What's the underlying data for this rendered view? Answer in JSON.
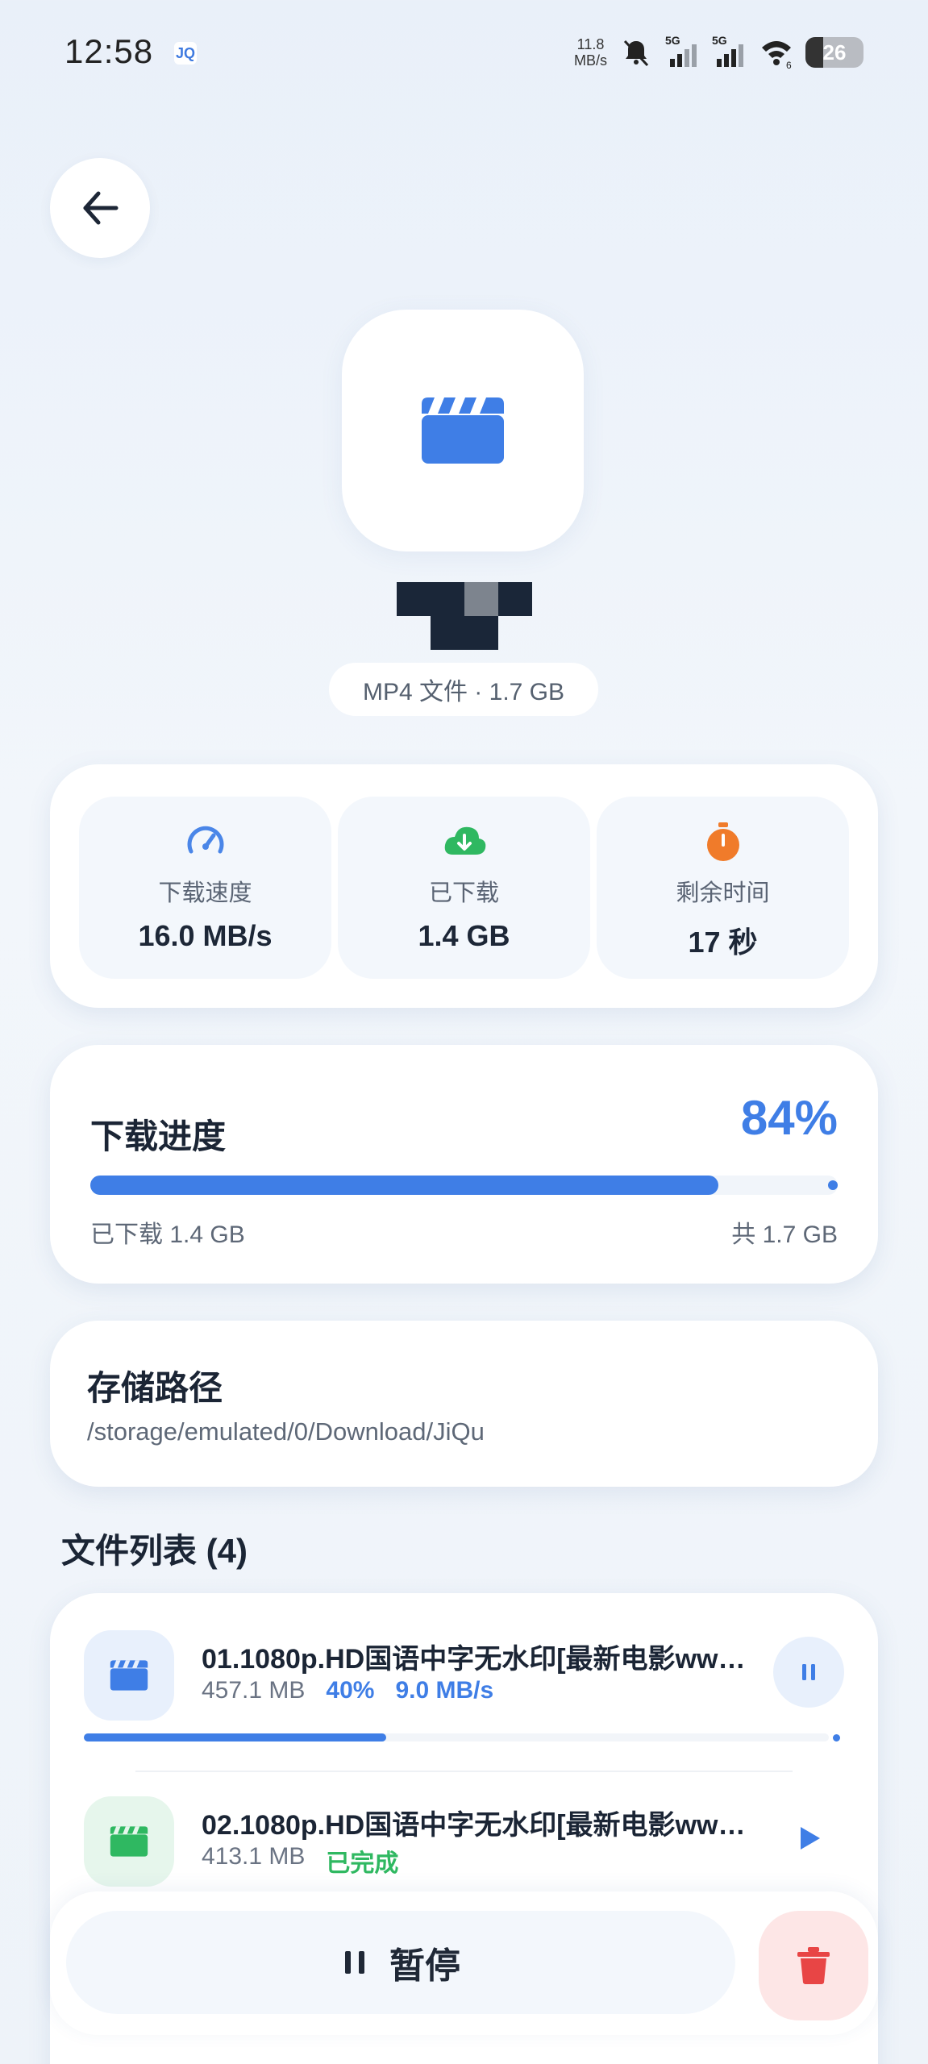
{
  "status_bar": {
    "time": "12:58",
    "app_icon": "JQ",
    "net_speed_value": "11.8",
    "net_speed_unit": "MB/s",
    "signal1_label": "5G",
    "signal2_label": "5G",
    "wifi_level": "6",
    "battery": "26",
    "icons": [
      "mute-bell-icon",
      "signal-icon",
      "signal-icon",
      "wifi-icon",
      "battery-icon"
    ]
  },
  "header": {
    "back_icon": "arrow-left-icon"
  },
  "hero": {
    "icon": "clapperboard-icon",
    "meta": "MP4 文件 · 1.7 GB"
  },
  "stats": [
    {
      "icon": "speedometer-icon",
      "label": "下载速度",
      "value": "16.0 MB/s",
      "color": "#4a86e8"
    },
    {
      "icon": "cloud-download-icon",
      "label": "已下载",
      "value": "1.4 GB",
      "color": "#2fb861"
    },
    {
      "icon": "stopwatch-icon",
      "label": "剩余时间",
      "value": "17 秒",
      "color": "#f07b2a"
    }
  ],
  "progress": {
    "title": "下载进度",
    "percent_label": "84%",
    "percent": 84,
    "downloaded_label": "已下载 1.4 GB",
    "total_label": "共 1.7 GB"
  },
  "storage": {
    "title": "存储路径",
    "path": "/storage/emulated/0/Download/JiQu"
  },
  "files": {
    "heading": "文件列表 (4)",
    "items": [
      {
        "name": "01.1080p.HD国语中字无水印[最新电影ww…",
        "size": "457.1 MB",
        "percent_label": "40%",
        "speed": "9.0 MB/s",
        "percent": 40,
        "status": "downloading",
        "icon": "clapperboard-icon",
        "action_icon": "pause-icon"
      },
      {
        "name": "02.1080p.HD国语中字无水印[最新电影ww…",
        "size": "413.1 MB",
        "status_label": "已完成",
        "status": "completed",
        "icon": "clapperboard-icon",
        "action_icon": "play-icon"
      }
    ]
  },
  "actions": {
    "pause_label": "暂停",
    "pause_icon": "pause-icon",
    "delete_icon": "trash-icon"
  },
  "colors": {
    "accent": "#3f7ee6",
    "success": "#2fb861",
    "warning": "#f07b2a",
    "danger": "#e84545"
  }
}
